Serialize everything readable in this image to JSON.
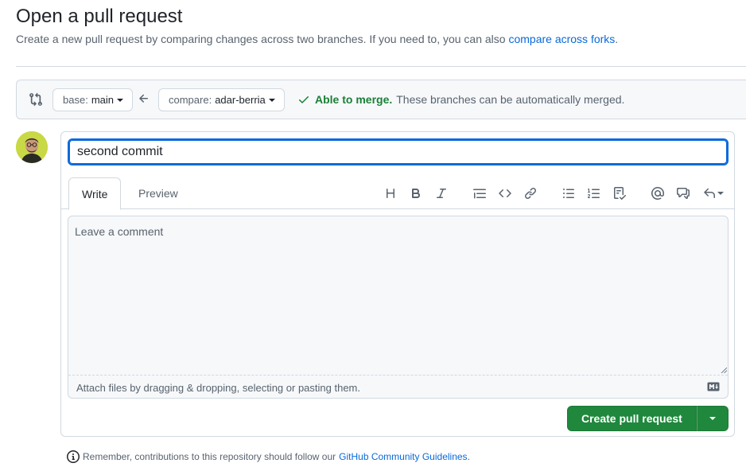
{
  "header": {
    "title": "Open a pull request",
    "subtitle": "Create a new pull request by comparing changes across two branches. If you need to, you can also",
    "subtitle_link": "compare across forks",
    "subtitle_end": "."
  },
  "range": {
    "base_label": "base:",
    "base_branch": "main",
    "compare_label": "compare:",
    "compare_branch": "adar-berria",
    "merge_ok": "Able to merge.",
    "merge_text": "These branches can be automatically merged."
  },
  "form": {
    "title_value": "second commit",
    "tabs": [
      {
        "label": "Write"
      },
      {
        "label": "Preview"
      }
    ],
    "comment_placeholder": "Leave a comment",
    "attach_text": "Attach files by dragging & dropping, selecting or pasting them.",
    "toolbar_icons": [
      "heading-icon",
      "bold-icon",
      "italic-icon",
      "quote-icon",
      "code-icon",
      "link-icon",
      "bulleted-list-icon",
      "numbered-list-icon",
      "task-list-icon",
      "mention-icon",
      "cross-reference-icon",
      "reply-icon"
    ],
    "create_label": "Create pull request"
  },
  "footer": {
    "text": "Remember, contributions to this repository should follow our",
    "link": "GitHub Community Guidelines",
    "end": "."
  },
  "colors": {
    "accent": "#0969da",
    "success": "#1a7f37",
    "button_green": "#1f883d",
    "avatar_bg": "#c9d845"
  }
}
